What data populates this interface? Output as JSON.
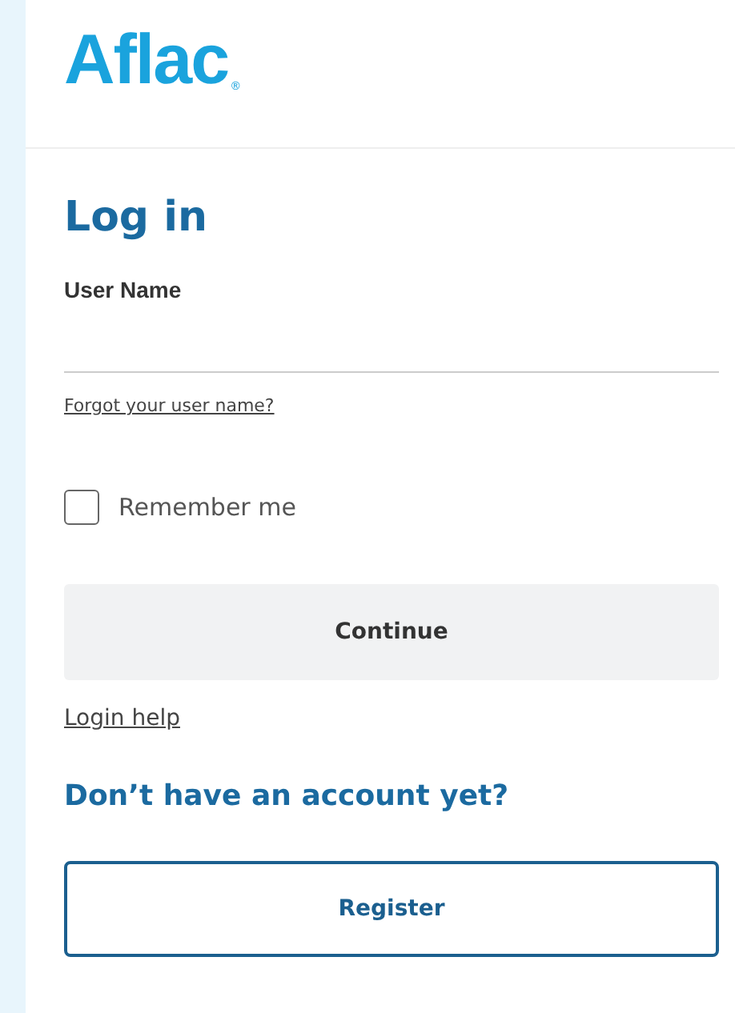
{
  "logo": {
    "text": "Aflac",
    "mark": "®"
  },
  "form": {
    "title": "Log in",
    "username": {
      "label": "User Name"
    },
    "forgot_link": "Forgot your user name?",
    "remember": {
      "label": "Remember me",
      "checked": false
    },
    "continue_button": "Continue",
    "help_link": "Login help"
  },
  "register": {
    "heading": "Don’t have an account yet?",
    "button": "Register"
  }
}
